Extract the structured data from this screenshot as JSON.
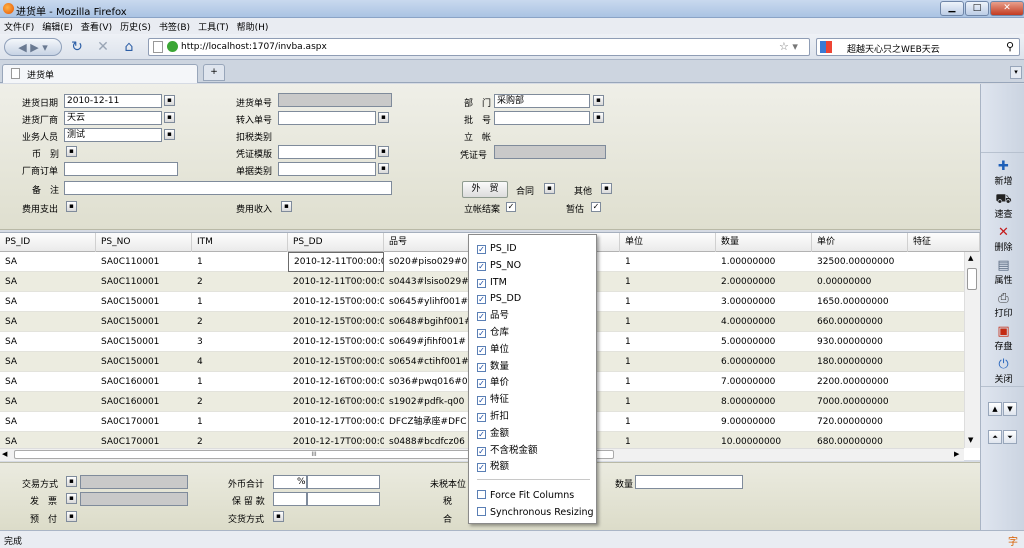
{
  "window": {
    "title": "进货单 - Mozilla Firefox",
    "min": "▁",
    "max": "□",
    "close": "✕"
  },
  "menu": [
    "文件(F)",
    "编辑(E)",
    "查看(V)",
    "历史(S)",
    "书签(B)",
    "工具(T)",
    "帮助(H)"
  ],
  "nav": {
    "url": "http://localhost:1707/invba.aspx",
    "search": "超越天心只之WEB天云"
  },
  "tab": {
    "label": "进货单",
    "new_tab": "+"
  },
  "form": {
    "date_label": "进货日期",
    "date_value": "2010-12-11",
    "vendor_label": "进货厂商",
    "vendor_value": "天云",
    "staff_label": "业务人员",
    "staff_value": "测试",
    "currency_label": "币　别",
    "order_label": "厂商订单",
    "note_label": "备　注",
    "expense_label": "费用支出",
    "doc_no_label": "进货单号",
    "transfer_label": "转入单号",
    "tax_type_label": "扣税类别",
    "voucher_tpl_label": "凭证模版",
    "doc_type_label": "单据类别",
    "income_label": "费用收入",
    "dept_label": "部　门",
    "dept_value": "采购部",
    "batch_label": "批　号",
    "account_label": "立　帐",
    "voucher_no_label": "凭证号",
    "foreign_btn": "外　贸",
    "contract_label": "合同",
    "other_label": "其他",
    "settle_label": "立帐结案",
    "estimate_label": "暂估"
  },
  "grid": {
    "columns": [
      "PS_ID",
      "PS_NO",
      "ITM",
      "PS_DD",
      "品号",
      "单位",
      "数量",
      "单价",
      "特征"
    ],
    "rows": [
      [
        "SA",
        "SA0C110001",
        "1",
        "2010-12-11T00:00:0",
        "s020#piso029#0",
        "1",
        "1.00000000",
        "32500.00000000"
      ],
      [
        "SA",
        "SA0C110001",
        "2",
        "2010-12-11T00:00:0",
        "s0443#lsiso029#",
        "1",
        "2.00000000",
        "0.00000000"
      ],
      [
        "SA",
        "SA0C150001",
        "1",
        "2010-12-15T00:00:0",
        "s0645#ylihf001#",
        "1",
        "3.00000000",
        "1650.00000000"
      ],
      [
        "SA",
        "SA0C150001",
        "2",
        "2010-12-15T00:00:0",
        "s0648#bgihf001#",
        "1",
        "4.00000000",
        "660.00000000"
      ],
      [
        "SA",
        "SA0C150001",
        "3",
        "2010-12-15T00:00:0",
        "s0649#jfihf001#",
        "1",
        "5.00000000",
        "930.00000000"
      ],
      [
        "SA",
        "SA0C150001",
        "4",
        "2010-12-15T00:00:0",
        "s0654#ctihf001#",
        "1",
        "6.00000000",
        "180.00000000"
      ],
      [
        "SA",
        "SA0C160001",
        "1",
        "2010-12-16T00:00:0",
        "s036#pwq016#0",
        "1",
        "7.00000000",
        "2200.00000000"
      ],
      [
        "SA",
        "SA0C160001",
        "2",
        "2010-12-16T00:00:0",
        "s1902#pdfk-q00",
        "1",
        "8.00000000",
        "7000.00000000"
      ],
      [
        "SA",
        "SA0C170001",
        "1",
        "2010-12-17T00:00:0",
        "DFCZ轴承座#DFC",
        "1",
        "9.00000000",
        "720.00000000"
      ],
      [
        "SA",
        "SA0C170001",
        "2",
        "2010-12-17T00:00:0",
        "s0488#bcdfcz06",
        "1",
        "10.00000000",
        "680.00000000"
      ]
    ],
    "hscroll_mark": "III"
  },
  "popup": {
    "items": [
      "PS_ID",
      "PS_NO",
      "ITM",
      "PS_DD",
      "品号",
      "仓库",
      "单位",
      "数量",
      "单价",
      "特征",
      "折扣",
      "金额",
      "不含税金额",
      "税额"
    ],
    "options": [
      "Force Fit Columns",
      "Synchronous Resizing"
    ]
  },
  "footer": {
    "trade_label": "交易方式",
    "invoice_label": "发　票",
    "prepay_label": "预　付",
    "foreign_total_label": "外币合计",
    "pct": "%",
    "retain_label": "保 留 款",
    "delivery_label": "交货方式",
    "untaxed_label": "未税本位",
    "tax_label": "税",
    "total_label": "合",
    "qty_label": "数量"
  },
  "tools": [
    {
      "icon": "✚",
      "label": "新增",
      "color": "#1d5fb8"
    },
    {
      "icon": "⛟",
      "label": "速查",
      "color": "#222"
    },
    {
      "icon": "✕",
      "label": "删除",
      "color": "#c41818"
    },
    {
      "icon": "▤",
      "label": "属性",
      "color": "#5a6b82"
    },
    {
      "icon": "⎙",
      "label": "打印",
      "color": "#3d3d3d"
    },
    {
      "icon": "▣",
      "label": "存盘",
      "color": "#c42a12"
    },
    {
      "icon": "⏻",
      "label": "关闭",
      "color": "#2f6bbf"
    }
  ],
  "status": {
    "text": "完成",
    "ime": "字"
  }
}
